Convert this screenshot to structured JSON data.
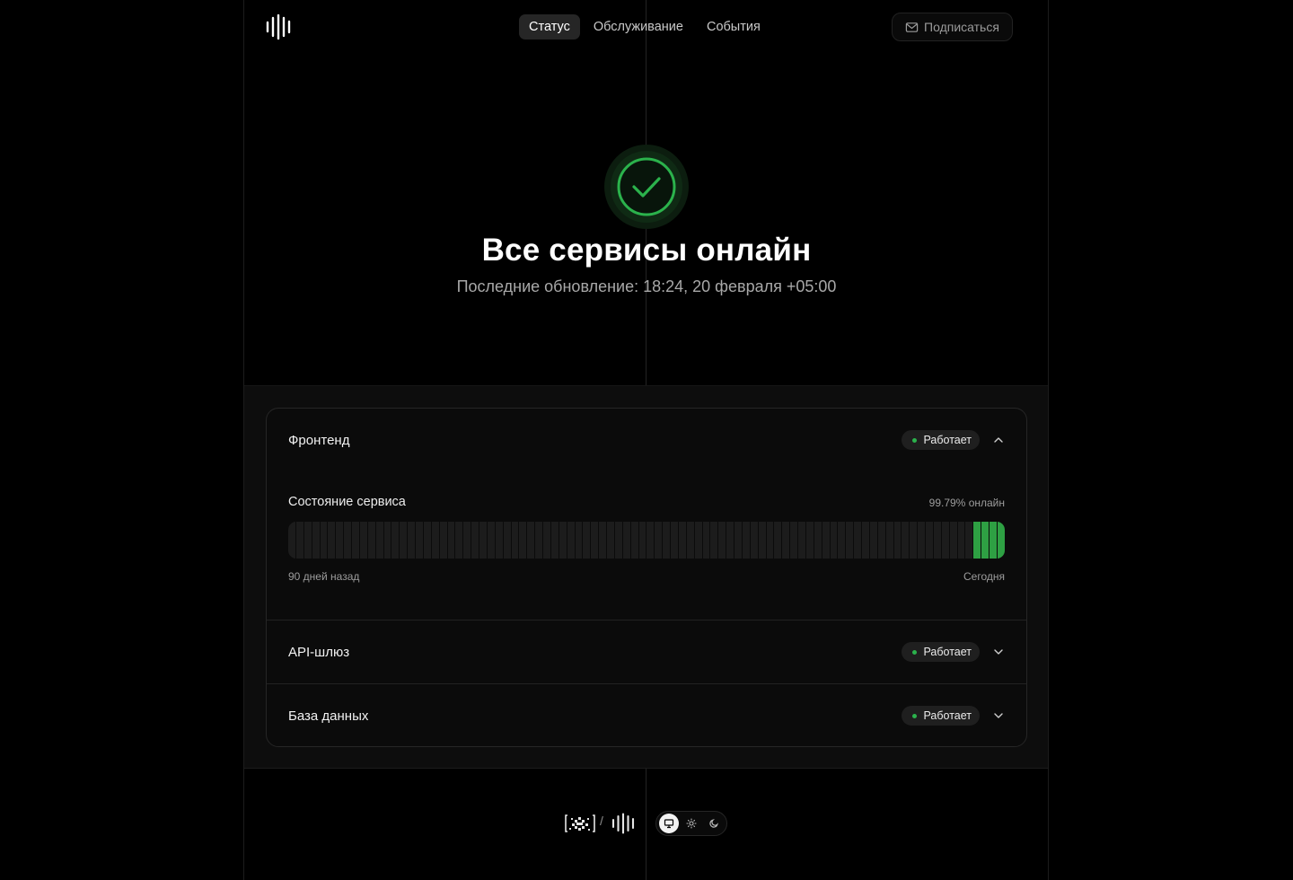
{
  "nav": {
    "items": [
      {
        "label": "Статус",
        "active": true
      },
      {
        "label": "Обслуживание",
        "active": false
      },
      {
        "label": "События",
        "active": false
      }
    ],
    "subscribe_label": "Подписаться"
  },
  "hero": {
    "title": "Все сервисы онлайн",
    "subtitle": "Последние обновление: 18:24, 20 февраля +05:00",
    "status_icon": "check-circle-icon",
    "accent_color": "#2bb24c"
  },
  "services": [
    {
      "name": "Фронтенд",
      "status": "Работает",
      "expanded": true,
      "uptime": {
        "label": "Состояние сервиса",
        "percent_text": "99.79% онлайн",
        "start_label": "90 дней назад",
        "end_label": "Сегодня",
        "days_total": 90,
        "days_with_data": 4
      }
    },
    {
      "name": "API-шлюз",
      "status": "Работает",
      "expanded": false
    },
    {
      "name": "База данных",
      "status": "Работает",
      "expanded": false
    }
  ],
  "footer": {
    "separator": "/",
    "theme_options": [
      "monitor-icon",
      "sun-icon",
      "moon-icon"
    ],
    "theme_selected": "monitor-icon"
  },
  "colors": {
    "ok": "#2ea043",
    "empty_bar": "#1c1c1c",
    "background": "#000000"
  }
}
